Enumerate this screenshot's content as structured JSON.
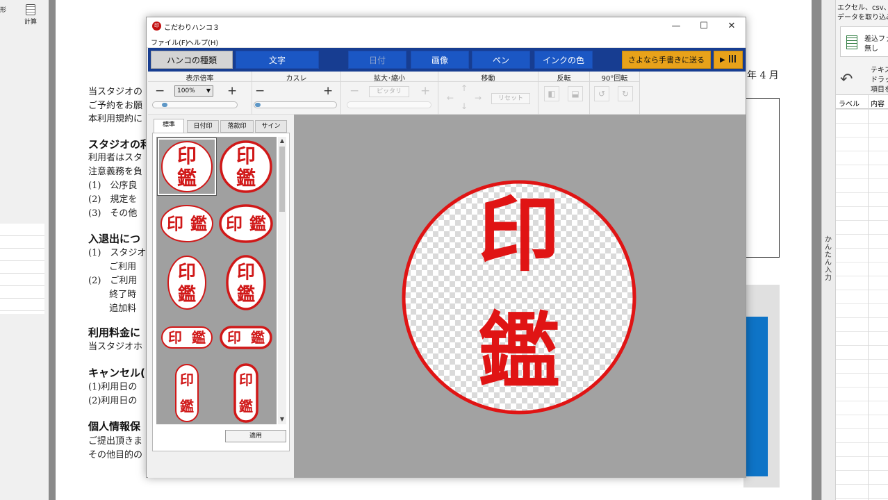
{
  "background_app": {
    "tools": {
      "shape_label": "形",
      "calc_label": "計算"
    },
    "document": {
      "date_fragment": "年 4 月",
      "lines": [
        {
          "text": "当スタジオの",
          "heading": false
        },
        {
          "text": "ご予約をお願",
          "heading": false
        },
        {
          "text": "本利用規約に",
          "heading": false
        },
        {
          "text": "スタジオの利",
          "heading": true
        },
        {
          "text": "利用者はスタ",
          "heading": false
        },
        {
          "text": "注意義務を負",
          "heading": false
        },
        {
          "text": "(1)　公序良",
          "heading": false
        },
        {
          "text": "(2)　規定を",
          "heading": false
        },
        {
          "text": "(3)　その他",
          "heading": false
        },
        {
          "text": "入退出につ",
          "heading": true
        },
        {
          "text": "(1)　スタジオ",
          "heading": false
        },
        {
          "text": "　　 ご利用",
          "heading": false
        },
        {
          "text": "(2)　ご利用",
          "heading": false
        },
        {
          "text": "　　 終了時",
          "heading": false
        },
        {
          "text": "　　 追加料",
          "heading": false
        },
        {
          "text": "利用料金に",
          "heading": true
        },
        {
          "text": "当スタジオホ",
          "heading": false
        },
        {
          "text": "キャンセル(",
          "heading": true
        },
        {
          "text": "(1)利用日の",
          "heading": false
        },
        {
          "text": "(2)利用日の",
          "heading": false
        },
        {
          "text": "個人情報保",
          "heading": true
        },
        {
          "text": "ご提出頂きま",
          "heading": false
        },
        {
          "text": "その他目的の",
          "heading": false
        }
      ]
    },
    "side_pane": {
      "line1": "エクセル、csv、墨",
      "line2": "データを取り込み",
      "merge_file_label": "差込ファ",
      "merge_file_value": "無し",
      "text_hint1": "テキス",
      "text_hint2": "ドラッ",
      "text_hint3": "項目を",
      "col_label": "ラベル",
      "col_content": "内容",
      "vertical_tab": "かんたん入力"
    }
  },
  "app": {
    "logo_char": "印",
    "title": "こだわりハンコ３",
    "window_buttons": {
      "minimize": "—",
      "maximize": "☐",
      "close": "✕"
    },
    "menu": [
      "ファイル(F)",
      "ヘルプ(H)"
    ],
    "tabs": [
      {
        "label": "ハンコの種類",
        "state": "active"
      },
      {
        "label": "文字",
        "state": "normal"
      },
      {
        "label": "日付",
        "state": "disabled"
      },
      {
        "label": "画像",
        "state": "normal"
      },
      {
        "label": "ペン",
        "state": "normal"
      },
      {
        "label": "インクの色",
        "state": "normal"
      }
    ],
    "send_button": "さよなら手書きに送る",
    "grid_button": "▶",
    "toolbar": {
      "zoom": {
        "label": "表示倍率",
        "value": "100%",
        "slider": 0.12
      },
      "blur": {
        "label": "カスレ",
        "slider": 0.0
      },
      "scale": {
        "label": "拡大･縮小",
        "fit_label": "ピッタリ"
      },
      "move": {
        "label": "移動",
        "reset_label": "リセット"
      },
      "flip": {
        "label": "反転"
      },
      "rotate": {
        "label": "90°回転"
      }
    },
    "panel": {
      "tabs": [
        "標準",
        "日付印",
        "落款印",
        "サイン"
      ],
      "active_tab": 0,
      "apply_label": "適用",
      "stamp_chars": [
        "印",
        "鑑"
      ],
      "stamp_shapes": [
        "circle",
        "circle-bold",
        "oval-h",
        "oval-h-bold",
        "oval-v",
        "oval-v-bold",
        "pill-h",
        "pill-h-bold",
        "pill-v",
        "pill-v-bold"
      ]
    },
    "preview": {
      "chars": [
        "印",
        "鑑"
      ],
      "ink_color": "#e01414",
      "shape": "circle"
    }
  },
  "colors": {
    "tab_bar": "#173d91",
    "tab_button": "#1b57c4",
    "send_button": "#e8a21a",
    "ink": "#d01818"
  }
}
